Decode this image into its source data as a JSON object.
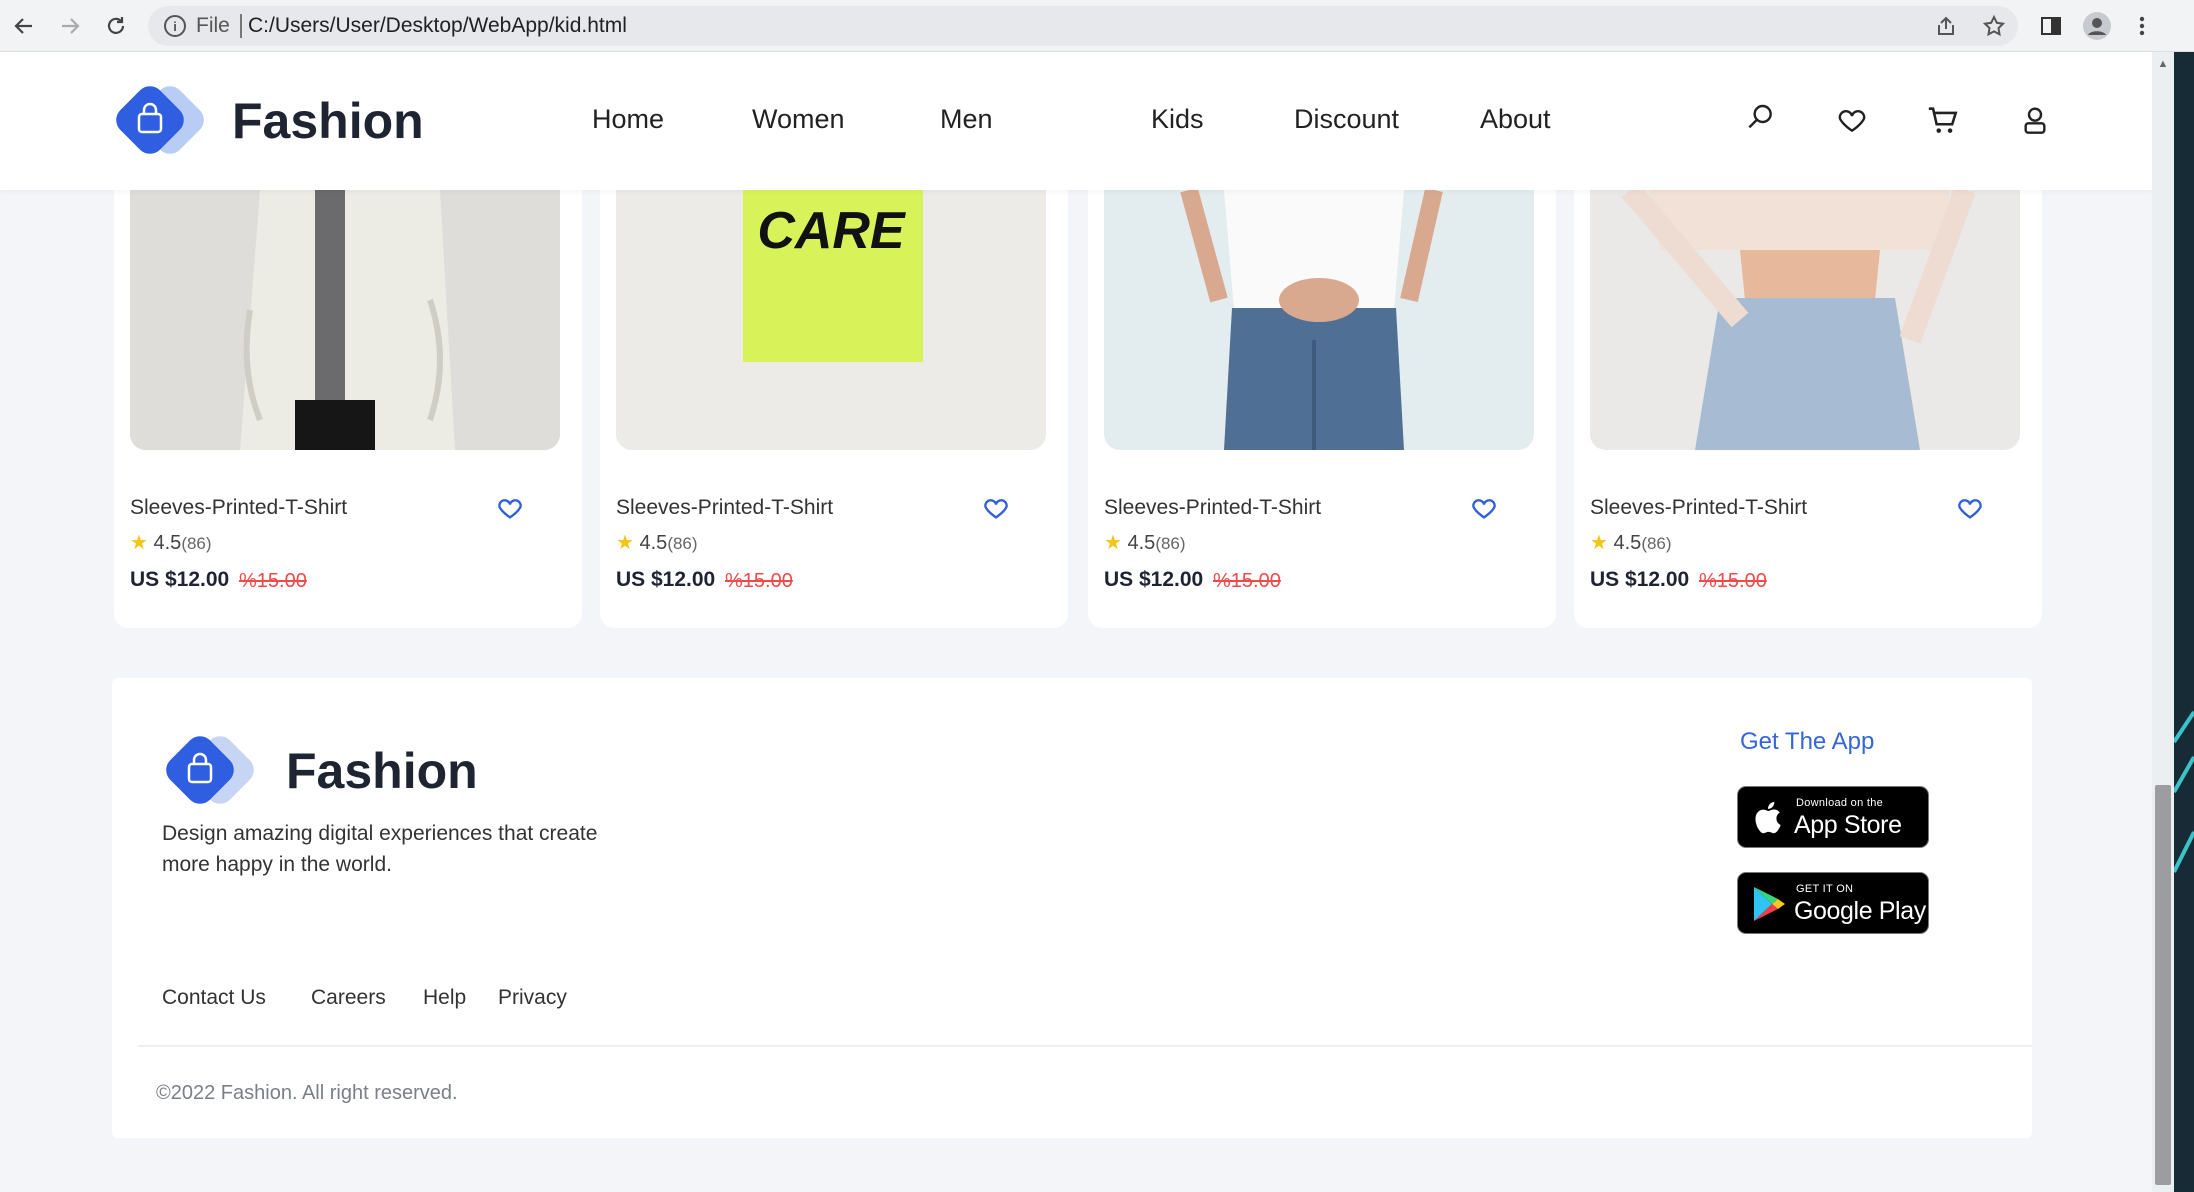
{
  "browser": {
    "file_label": "File",
    "url": "C:/Users/User/Desktop/WebApp/kid.html"
  },
  "brand": {
    "name": "Fashion",
    "accent": "#2f5fe0"
  },
  "nav": {
    "items": [
      {
        "label": "Home"
      },
      {
        "label": "Women"
      },
      {
        "label": "Men"
      },
      {
        "label": "Kids"
      },
      {
        "label": "Discount"
      },
      {
        "label": "About"
      }
    ]
  },
  "products": [
    {
      "name": "Sleeves-Printed-T-Shirt",
      "rating": "4.5",
      "reviews": "(86)",
      "price": "US $12.00",
      "old_price": "%15.00",
      "image_text": ""
    },
    {
      "name": "Sleeves-Printed-T-Shirt",
      "rating": "4.5",
      "reviews": "(86)",
      "price": "US $12.00",
      "old_price": "%15.00",
      "image_text": "CARE"
    },
    {
      "name": "Sleeves-Printed-T-Shirt",
      "rating": "4.5",
      "reviews": "(86)",
      "price": "US $12.00",
      "old_price": "%15.00",
      "image_text": ""
    },
    {
      "name": "Sleeves-Printed-T-Shirt",
      "rating": "4.5",
      "reviews": "(86)",
      "price": "US $12.00",
      "old_price": "%15.00",
      "image_text": ""
    }
  ],
  "footer": {
    "brand": "Fashion",
    "description": "Design amazing digital experiences that create more happy in the world.",
    "get_app": "Get The App",
    "app_store": {
      "small": "Download on the",
      "big": "App Store"
    },
    "google_play": {
      "small": "GET IT ON",
      "big": "Google Play"
    },
    "links": [
      {
        "label": "Contact Us"
      },
      {
        "label": "Careers"
      },
      {
        "label": "Help"
      },
      {
        "label": "Privacy"
      }
    ],
    "copyright": "©2022 Fashion. All right reserved."
  }
}
